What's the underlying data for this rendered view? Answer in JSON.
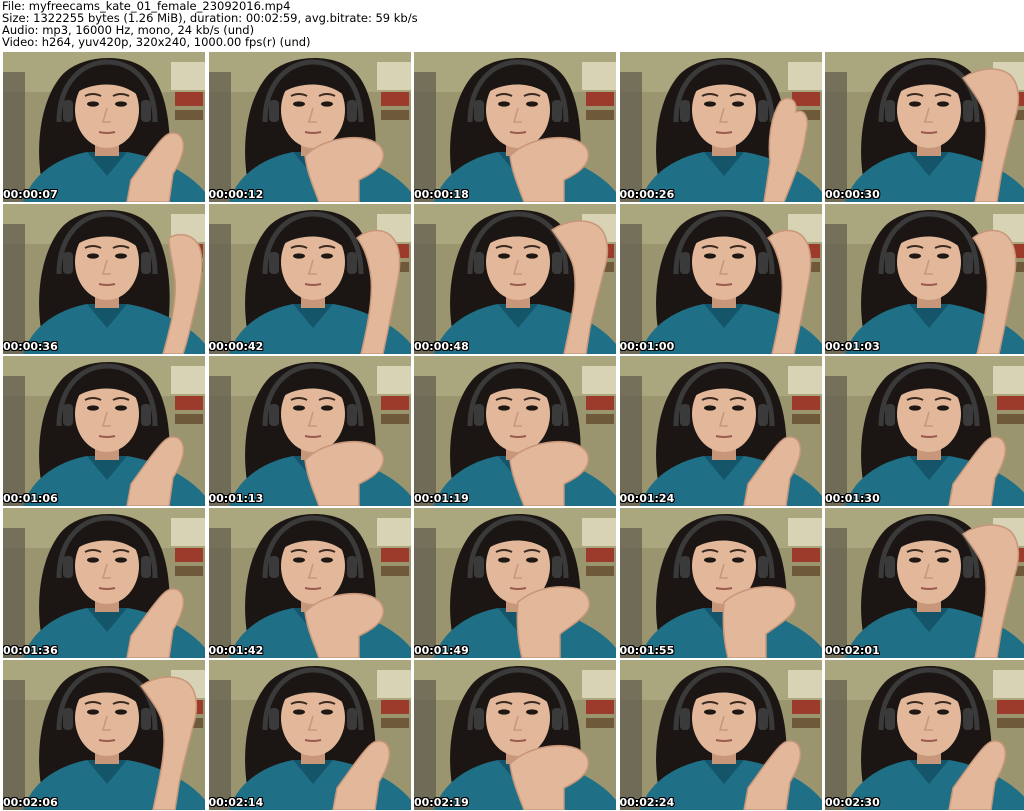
{
  "header": {
    "file_line": "File: myfreecams_kate_01_female_23092016.mp4",
    "size_line": "Size: 1322255 bytes (1.26 MiB), duration: 00:02:59, avg.bitrate: 59 kb/s",
    "audio_line": "Audio: mp3, 16000 Hz, mono, 24 kb/s (und)",
    "video_line": "Video: h264, yuv420p, 320x240, 1000.00 fps(r) (und)"
  },
  "thumbnails": [
    {
      "timestamp": "00:00:07",
      "hand": "chin-right"
    },
    {
      "timestamp": "00:00:12",
      "hand": "mouth"
    },
    {
      "timestamp": "00:00:18",
      "hand": "mouth"
    },
    {
      "timestamp": "00:00:26",
      "hand": "cheek-right"
    },
    {
      "timestamp": "00:00:30",
      "hand": "forehead"
    },
    {
      "timestamp": "00:00:36",
      "hand": "ear-right"
    },
    {
      "timestamp": "00:00:42",
      "hand": "temple"
    },
    {
      "timestamp": "00:00:48",
      "hand": "forehead"
    },
    {
      "timestamp": "00:01:00",
      "hand": "temple"
    },
    {
      "timestamp": "00:01:03",
      "hand": "temple"
    },
    {
      "timestamp": "00:01:06",
      "hand": "chin-right"
    },
    {
      "timestamp": "00:01:13",
      "hand": "mouth"
    },
    {
      "timestamp": "00:01:19",
      "hand": "mouth"
    },
    {
      "timestamp": "00:01:24",
      "hand": "chin-right"
    },
    {
      "timestamp": "00:01:30",
      "hand": "chin-right"
    },
    {
      "timestamp": "00:01:36",
      "hand": "chin-right"
    },
    {
      "timestamp": "00:01:42",
      "hand": "mouth"
    },
    {
      "timestamp": "00:01:49",
      "hand": "nose"
    },
    {
      "timestamp": "00:01:55",
      "hand": "nose"
    },
    {
      "timestamp": "00:02:01",
      "hand": "forehead"
    },
    {
      "timestamp": "00:02:06",
      "hand": "forehead"
    },
    {
      "timestamp": "00:02:14",
      "hand": "chin-right"
    },
    {
      "timestamp": "00:02:19",
      "hand": "mouth"
    },
    {
      "timestamp": "00:02:24",
      "hand": "chin-right"
    },
    {
      "timestamp": "00:02:30",
      "hand": "chin-right"
    }
  ],
  "colors": {
    "wall": "#9a956f",
    "wall_light": "#b8b48a",
    "hair": "#1b1613",
    "skin": "#e2b79a",
    "skin_shadow": "#c8977a",
    "shirt": "#1f6f86",
    "shirt_dark": "#155569",
    "headphone": "#3a3a3a",
    "shelf_red": "#9c3a2c",
    "curtain": "#5d5a4c"
  }
}
